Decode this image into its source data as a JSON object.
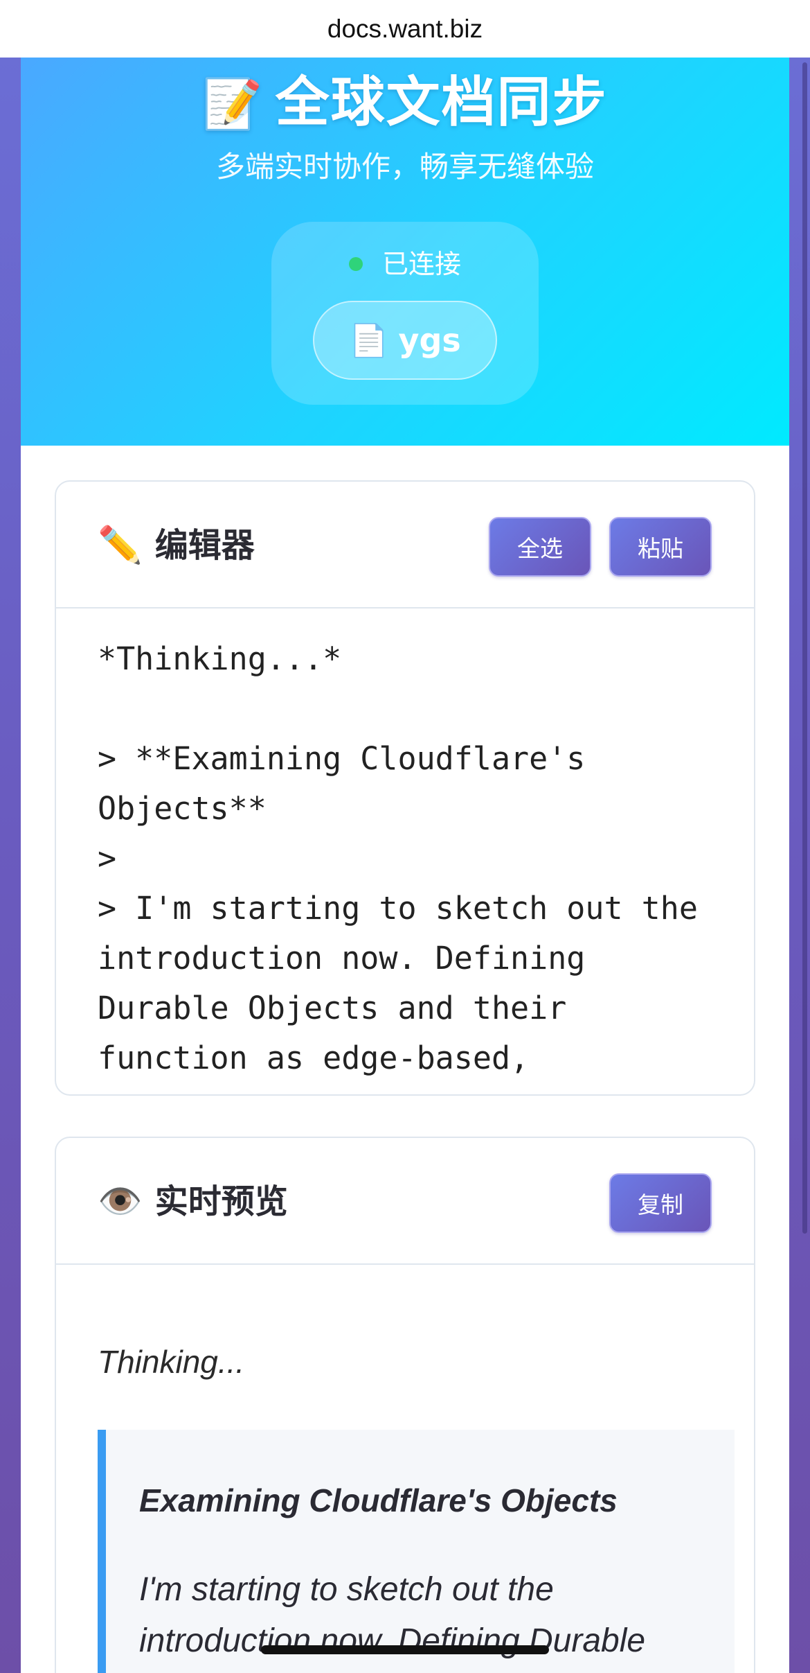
{
  "browser": {
    "url": "docs.want.biz"
  },
  "hero": {
    "icon": "memo-icon",
    "title": "全球文档同步",
    "subtitle": "多端实时协作，畅享无缝体验",
    "status": "已连接",
    "status_color": "#2fd37a",
    "doc_name": "ygs"
  },
  "editor": {
    "icon": "pencil-icon",
    "title": "编辑器",
    "select_all_label": "全选",
    "paste_label": "粘贴",
    "content": "*Thinking...*\n\n> **Examining Cloudflare's Objects**\n>\n> I'm starting to sketch out the introduction now. Defining Durable Objects and their function as edge-based,"
  },
  "preview": {
    "icon": "eye-icon",
    "title": "实时预览",
    "copy_label": "复制",
    "thinking": "Thinking...",
    "quote_heading": "Examining Cloudflare's Objects",
    "quote_text": "I'm starting to sketch out the introduction now. Defining Durable"
  },
  "colors": {
    "accent": "#6a6fe0",
    "hero_gradient_start": "#4aa8ff",
    "hero_gradient_end": "#00eaff",
    "quote_border": "#3a9cf2"
  }
}
